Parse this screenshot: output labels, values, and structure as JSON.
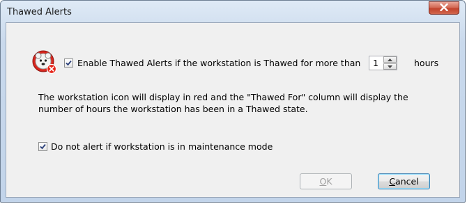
{
  "window": {
    "title": "Thawed Alerts"
  },
  "icons": {
    "app": "workstation-alert-icon",
    "close": "close-icon"
  },
  "enable_alerts": {
    "checked": true,
    "label": "Enable Thawed Alerts if the workstation is Thawed for more than",
    "hours_value": "1",
    "hours_label": "hours"
  },
  "description": "The workstation icon will display in red and the \"Thawed For\" column will display the number of hours the workstation has been in a Thawed state.",
  "maintenance": {
    "checked": true,
    "label": "Do not alert if workstation is in maintenance mode"
  },
  "buttons": {
    "ok_mnemonic": "O",
    "ok_rest": "K",
    "ok_enabled": false,
    "cancel_mnemonic": "C",
    "cancel_rest": "ancel"
  },
  "colors": {
    "close_button": "#c2432d",
    "default_button_border": "#3c7fb1"
  }
}
